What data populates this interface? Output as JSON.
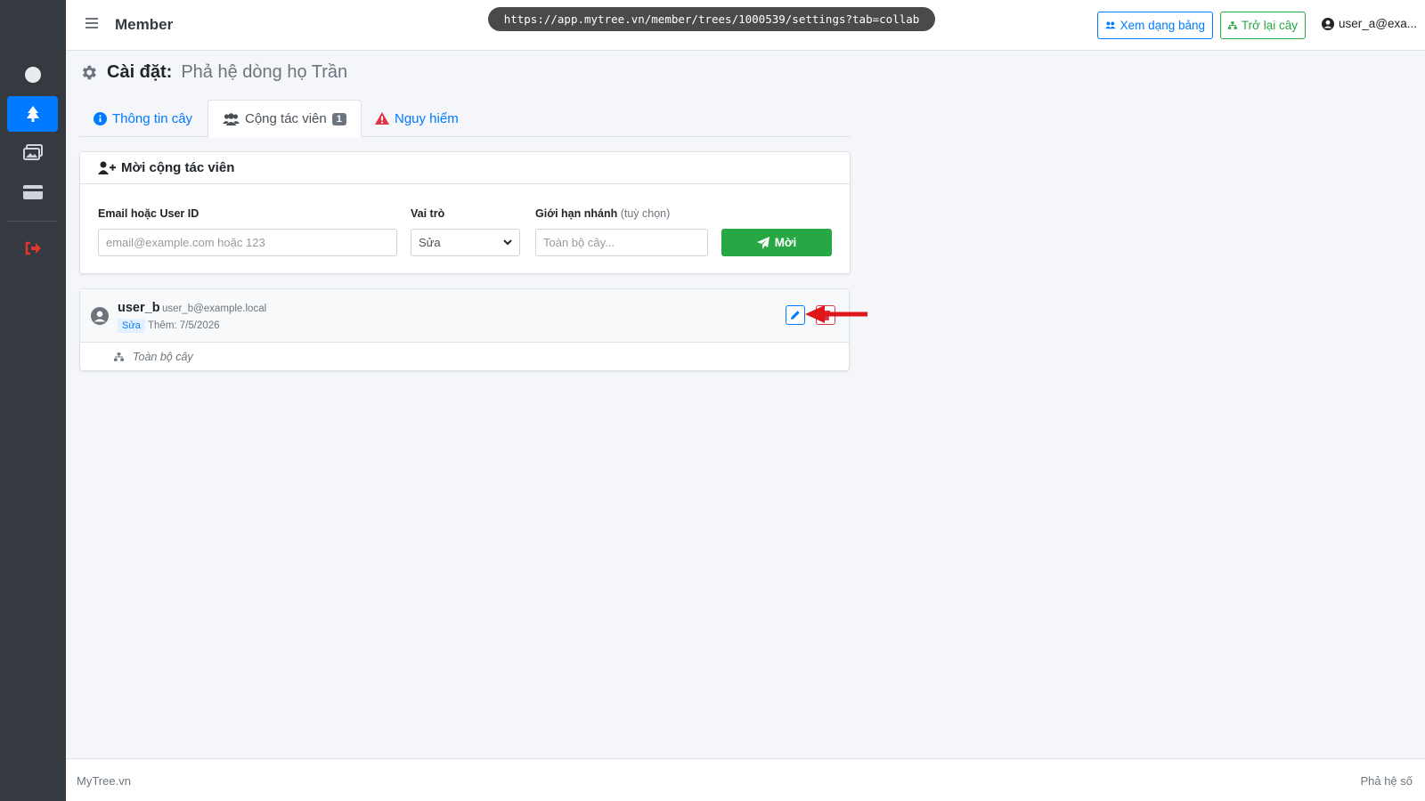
{
  "browser": {
    "url": "https://app.mytree.vn/member/trees/1000539/settings?tab=collab"
  },
  "navbar": {
    "title": "Member",
    "table_view_label": "Xem dạng bảng",
    "back_to_tree_label": "Trở lại cây",
    "user_label": "user_a@exa..."
  },
  "sidebar": {
    "items": [
      {
        "icon": "circle-icon",
        "active": false
      },
      {
        "icon": "tree-icon",
        "active": true
      },
      {
        "icon": "images-icon",
        "active": false
      },
      {
        "icon": "credit-card-icon",
        "active": false
      },
      {
        "icon": "sign-out-icon",
        "active": false
      }
    ]
  },
  "page": {
    "title_label": "Cài đặt:",
    "title_value": "Phả hệ dòng họ Trần"
  },
  "tabs": {
    "info": "Thông tin cây",
    "collab": "Cộng tác viên",
    "collab_count": "1",
    "danger": "Nguy hiểm",
    "active": "collab"
  },
  "invite": {
    "header": "Mời cộng tác viên",
    "email_label": "Email hoặc User ID",
    "email_placeholder": "email@example.com hoặc 123",
    "role_label": "Vai trò",
    "role_value": "Sửa",
    "limit_label": "Giới hạn nhánh",
    "limit_optional": "(tuỳ chọn)",
    "limit_placeholder": "Toàn bộ cây...",
    "submit_label": "Mời"
  },
  "collaborators": [
    {
      "name": "user_b",
      "email": "user_b@example.local",
      "role": "Sửa",
      "added": "Thêm: 7/5/2026",
      "scope": "Toàn bộ cây"
    }
  ],
  "footer": {
    "left": "MyTree.vn",
    "right": "Phả hệ số"
  },
  "colors": {
    "primary": "#007bff",
    "success": "#28a745",
    "danger": "#dc3545",
    "sidebar": "#343a40"
  }
}
